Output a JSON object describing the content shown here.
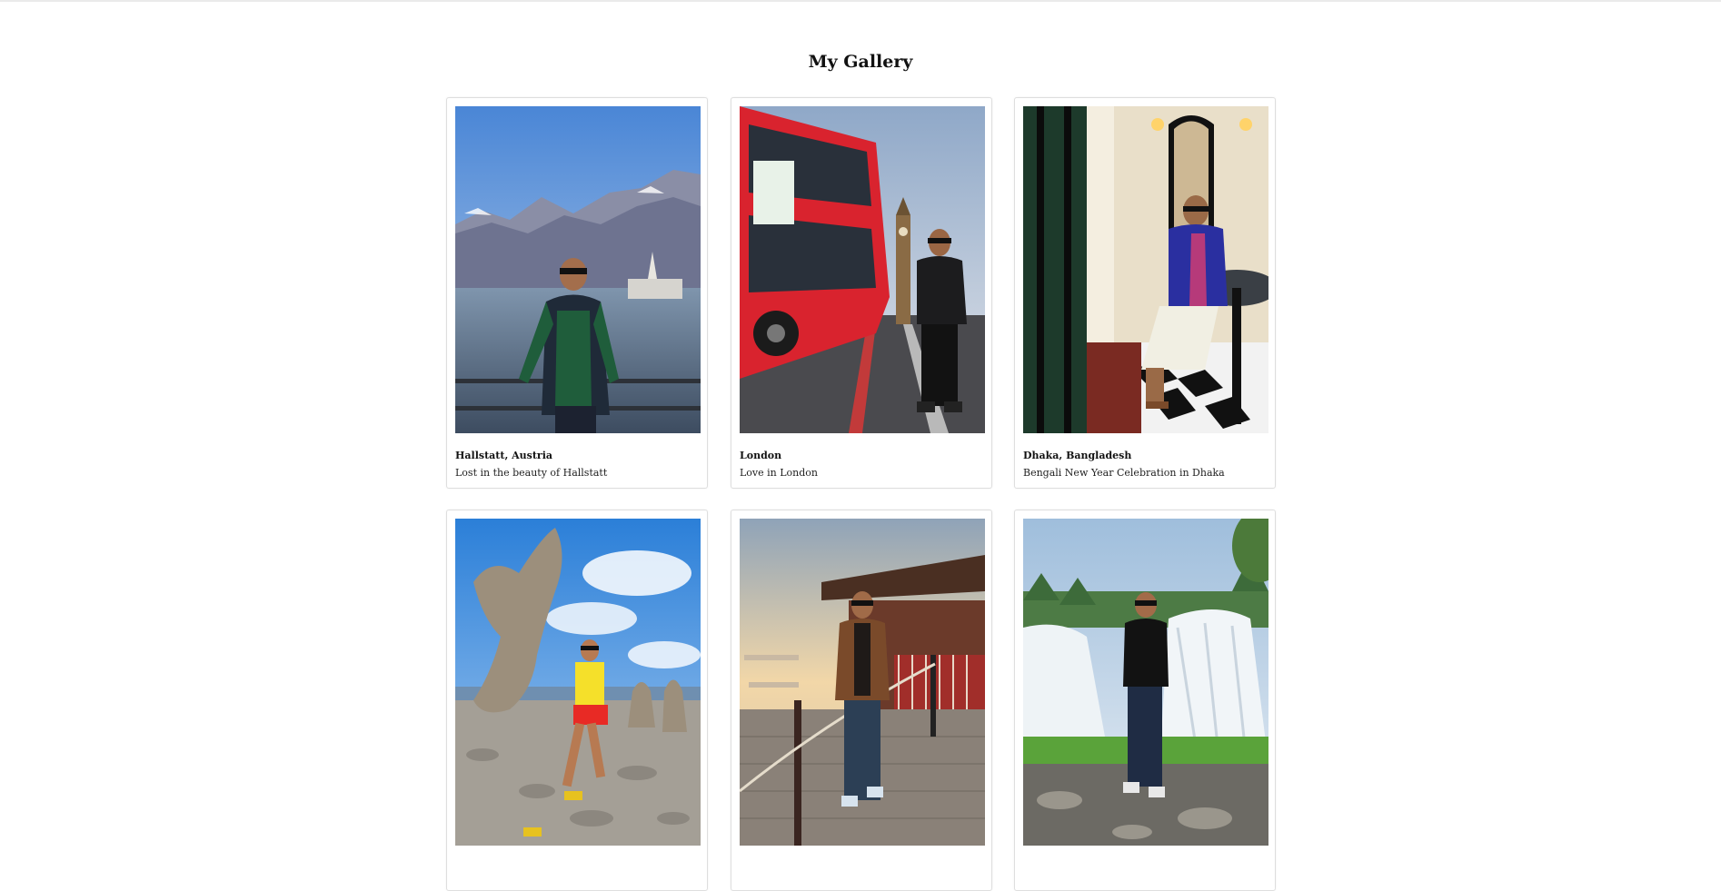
{
  "page": {
    "title": "My Gallery"
  },
  "gallery": {
    "items": [
      {
        "title": "Hallstatt, Austria",
        "description": "Lost in the beauty of Hallstatt",
        "scene": "mountain-lake"
      },
      {
        "title": "London",
        "description": "Love in London",
        "scene": "red-bus-big-ben"
      },
      {
        "title": "Dhaka, Bangladesh",
        "description": "Bengali New Year Celebration in Dhaka",
        "scene": "cafe-interior"
      },
      {
        "title": "",
        "description": "",
        "scene": "rock-stacks-coast"
      },
      {
        "title": "",
        "description": "",
        "scene": "cobblestone-terrace-sunset"
      },
      {
        "title": "",
        "description": "",
        "scene": "waterfall"
      }
    ]
  },
  "colors": {
    "border": "#dedede",
    "text": "#111111"
  }
}
